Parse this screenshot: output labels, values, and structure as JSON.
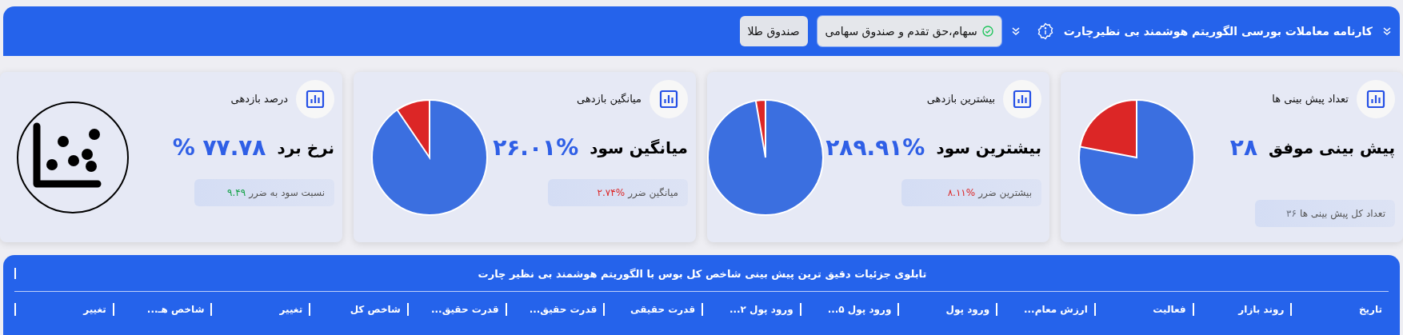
{
  "header": {
    "title": "کارنامه معاملات بورسی الگوریتم هوشمند بی نظیرچارت",
    "filters": [
      {
        "label": "سهام،حق تقدم و صندوق سهامی",
        "selected": true
      },
      {
        "label": "صندوق طلا",
        "selected": false
      }
    ]
  },
  "cards": [
    {
      "kind": "pie",
      "label": "تعداد پیش بینی ها",
      "title": "پیش بینی موفق",
      "value": "۲۸",
      "note": "تعداد کل پیش بینی ها",
      "note_value": "۳۶",
      "color": "#6b7280"
    },
    {
      "kind": "pie",
      "label": "بیشترین بازدهی",
      "title": "بیشترین سود",
      "value": "۲۸۹.۹۱%",
      "note": "بیشترین ضرر",
      "note_value": "۸.۱۱%",
      "color": "#dc2626"
    },
    {
      "kind": "pie",
      "label": "میانگین بازدهی",
      "title": "میانگین سود",
      "value": "۲۶.۰۱%",
      "note": "میانگین ضرر",
      "note_value": "۲.۷۴%",
      "color": "#dc2626"
    },
    {
      "kind": "scatter",
      "label": "درصد بازدهی",
      "title": "نرخ برد",
      "value": "۷۷.۷۸ %",
      "note": "نسبت سود به ضرر",
      "note_value": "۹.۴۹",
      "color": "#16a34a"
    }
  ],
  "table": {
    "title": "تابلوی جزئیات دقیق ترین پیش بینی شاخص کل بوس با الگوریتم هوشمند بی نظیر چارت",
    "columns": [
      "تاریخ",
      "روند بازار",
      "فعالیت",
      "ارزش معام...",
      "ورود پول",
      "ورود پول ۵...",
      "ورود پول ۲...",
      "قدرت حقیقی",
      "قدرت حقیق...",
      "قدرت حقیق...",
      "شاخص کل",
      "تغییر",
      "شاخص هـ...",
      "تغییر"
    ]
  }
}
